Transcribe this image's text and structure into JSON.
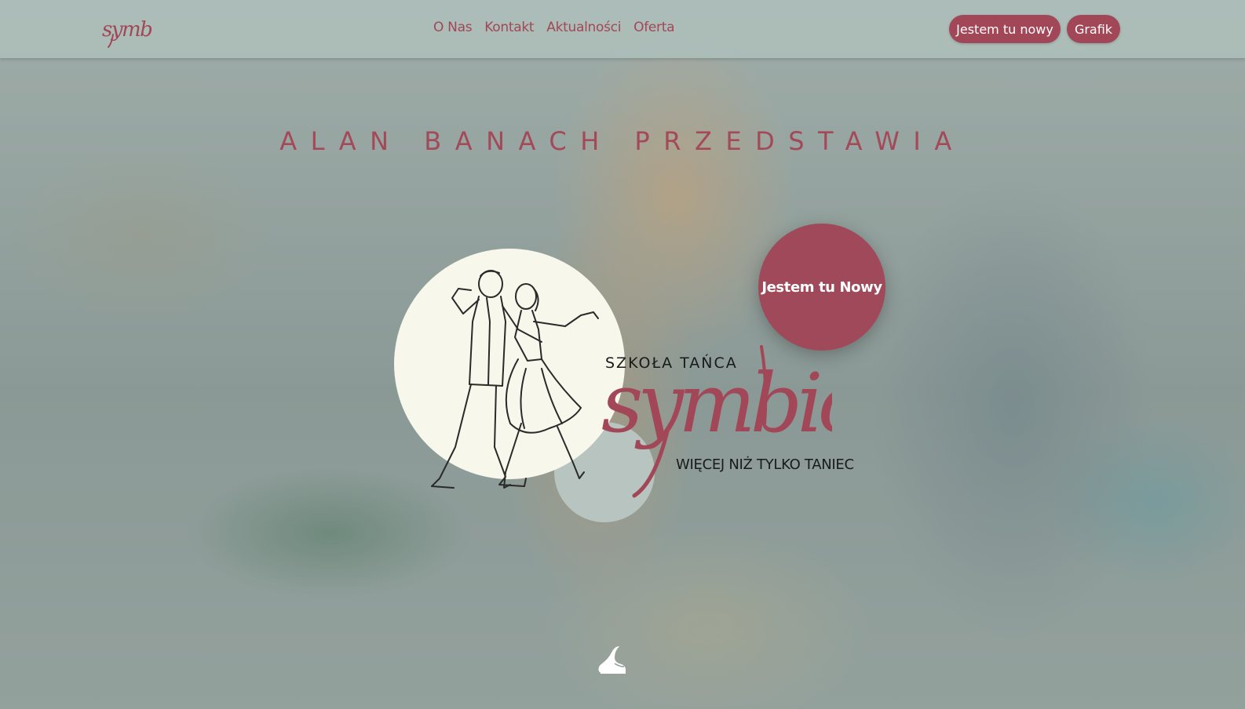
{
  "navbar": {
    "logo_text": "symbio",
    "links": [
      {
        "label": "O Nas"
      },
      {
        "label": "Kontakt"
      },
      {
        "label": "Aktualności"
      },
      {
        "label": "Oferta"
      }
    ],
    "buttons": {
      "new_here": "Jestem tu nowy",
      "schedule": "Grafik"
    }
  },
  "hero": {
    "headline": "ALAN BANACH PRZEDSTAWIA",
    "cta_label": "Jestem tu Nowy",
    "school_label": "SZKOŁA TAŃCA",
    "brand_name": "symbio",
    "tagline": "WIĘCEJ NIŻ TYLKO TANIEC"
  },
  "icons": {
    "dancers": "dancing-couple-illustration",
    "scroll": "dance-shoe-icon"
  },
  "colors": {
    "accent": "#a24758",
    "nav_bg": "#b2c4bf",
    "circle_light": "#f8f7ec",
    "circle_sage": "#b7c4bf",
    "text_dark": "#1a1a1a"
  }
}
